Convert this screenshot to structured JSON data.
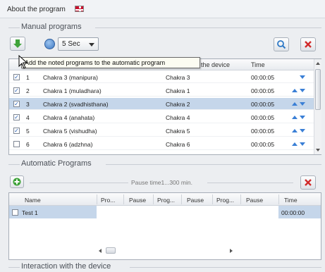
{
  "header": {
    "title": "About the program"
  },
  "manual": {
    "section_label": "Manual programs",
    "timer_value": "5 Sec",
    "tooltip": "Add the noted programs to the automatic program",
    "columns": {
      "device": "the device",
      "time": "Time"
    },
    "rows": [
      {
        "checked": true,
        "num": "1",
        "name": "Chakra 3 (manipura)",
        "device": "Chakra 3",
        "time": "00:00:05",
        "selected": false
      },
      {
        "checked": true,
        "num": "2",
        "name": "Chakra 1 (muladhara)",
        "device": "Chakra 1",
        "time": "00:00:05",
        "selected": false
      },
      {
        "checked": true,
        "num": "3",
        "name": "Chakra 2 (svadhisthana)",
        "device": "Chakra 2",
        "time": "00:00:05",
        "selected": true
      },
      {
        "checked": true,
        "num": "4",
        "name": "Chakra 4 (anahata)",
        "device": "Chakra 4",
        "time": "00:00:05",
        "selected": false
      },
      {
        "checked": true,
        "num": "5",
        "name": "Chakra 5 (vishudha)",
        "device": "Chakra 5",
        "time": "00:00:05",
        "selected": false
      },
      {
        "checked": false,
        "num": "6",
        "name": "Chakra 6 (adzhna)",
        "device": "Chakra 6",
        "time": "00:00:05",
        "selected": false
      }
    ]
  },
  "automatic": {
    "section_label": "Automatic Programs",
    "pause_label": "Pause time1...300 min.",
    "columns": [
      "Name",
      "Pro...",
      "Pause",
      "Prog...",
      "Pause",
      "Prog...",
      "Pause",
      "Time"
    ],
    "rows": [
      {
        "name": "Test 1",
        "time": "00:00:00"
      }
    ]
  },
  "interaction": {
    "section_label": "Interaction with the device"
  },
  "colors": {
    "selection": "#c5d6ea",
    "arrow_blue": "#3a7fd6",
    "close_red": "#d12a2a",
    "add_green": "#3fa33a"
  },
  "icons": {
    "flag": "uk-flag-icon",
    "download": "green-down-arrow-icon",
    "clock": "clock-icon",
    "search": "magnifier-icon",
    "close": "red-x-icon",
    "add": "green-plus-icon"
  }
}
